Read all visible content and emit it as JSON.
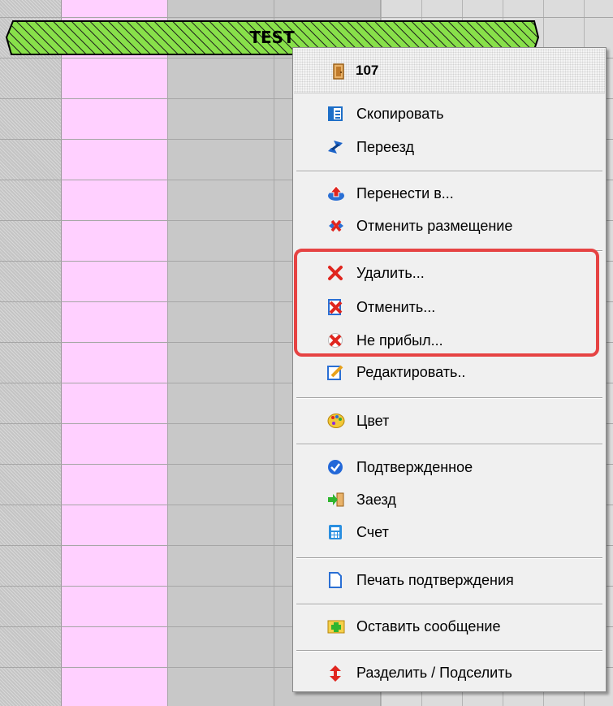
{
  "booking": {
    "label": "TEST",
    "color": "#88e04a"
  },
  "menu": {
    "header": {
      "icon": "door-icon",
      "text": "107"
    },
    "items": [
      {
        "id": "copy",
        "label": "Скопировать",
        "icon": "copy-document-icon"
      },
      {
        "id": "move",
        "label": "Переезд",
        "icon": "move-arrows-icon"
      },
      {
        "id": "transfer-to",
        "label": "Перенести в...",
        "icon": "transfer-icon"
      },
      {
        "id": "cancel-placement",
        "label": "Отменить размещение",
        "icon": "cancel-placement-icon"
      },
      {
        "id": "delete",
        "label": "Удалить...",
        "icon": "red-x-icon"
      },
      {
        "id": "cancel",
        "label": "Отменить...",
        "icon": "cancel-document-icon"
      },
      {
        "id": "no-show",
        "label": "Не прибыл...",
        "icon": "red-x-circle-icon"
      },
      {
        "id": "edit",
        "label": "Редактировать..",
        "icon": "edit-pencil-icon"
      },
      {
        "id": "color",
        "label": "Цвет",
        "icon": "palette-icon"
      },
      {
        "id": "confirmed",
        "label": "Подтвержденное",
        "icon": "check-circle-icon"
      },
      {
        "id": "check-in",
        "label": "Заезд",
        "icon": "check-in-arrow-icon"
      },
      {
        "id": "invoice",
        "label": "Счет",
        "icon": "calculator-icon"
      },
      {
        "id": "print-confirmation",
        "label": "Печать подтверждения",
        "icon": "document-icon"
      },
      {
        "id": "leave-message",
        "label": "Оставить сообщение",
        "icon": "message-plus-icon"
      },
      {
        "id": "split",
        "label": "Разделить / Подселить",
        "icon": "split-arrows-icon"
      }
    ]
  },
  "colors": {
    "highlight": "#e64343",
    "pink_column": "#ffd0ff",
    "menu_bg": "#f0f0f0"
  }
}
